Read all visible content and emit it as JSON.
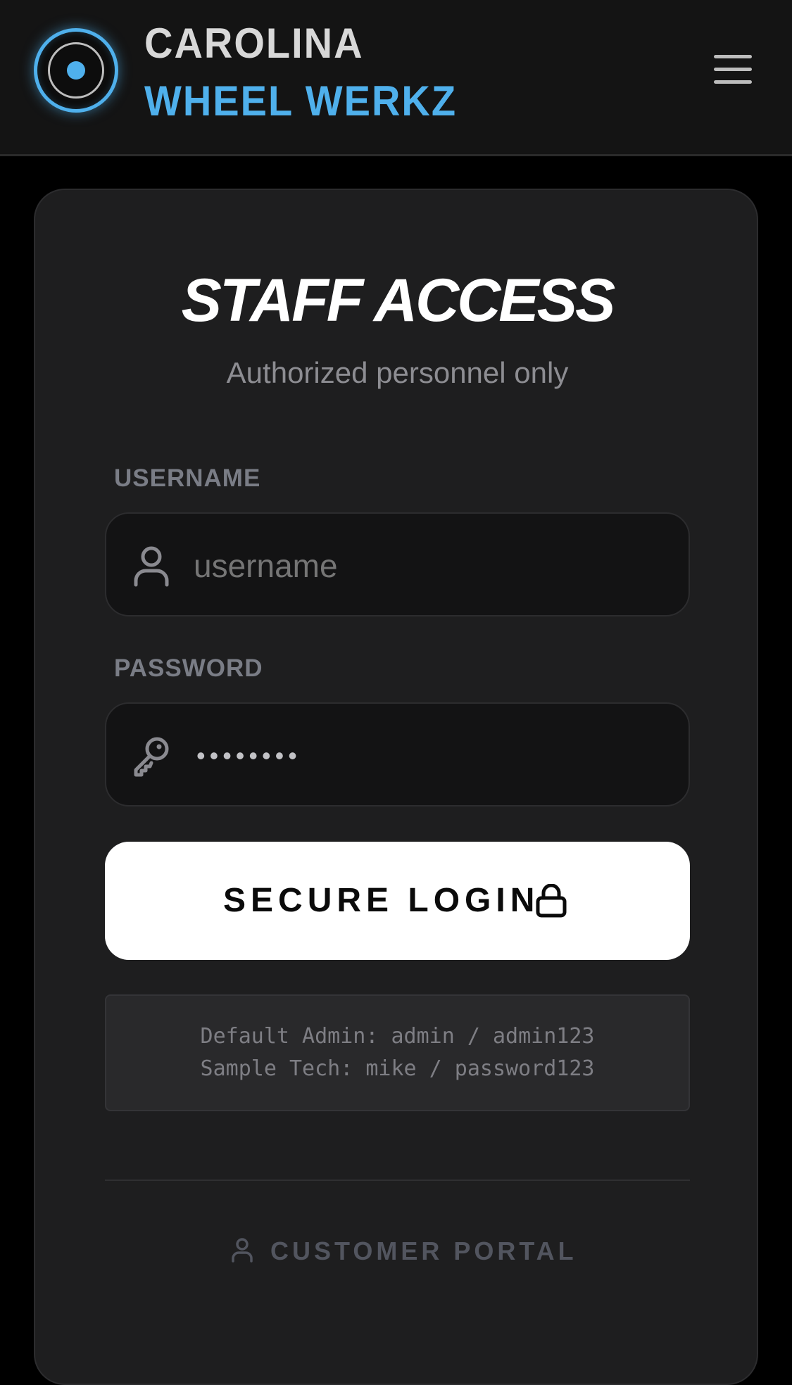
{
  "header": {
    "brand_line1": "CAROLINA",
    "brand_line2": "WHEEL WERKZ",
    "logo_icon": "wheel-logo-icon",
    "menu_icon": "hamburger-menu-icon"
  },
  "login": {
    "title": "STAFF ACCESS",
    "subtitle": "Authorized personnel only",
    "username": {
      "label": "USERNAME",
      "placeholder": "username",
      "value": "",
      "icon": "user-icon"
    },
    "password": {
      "label": "PASSWORD",
      "masked_value": "••••••••",
      "icon": "key-icon"
    },
    "submit": {
      "label": "SECURE LOGIN",
      "icon": "lock-icon"
    },
    "default_credentials": {
      "line1": "Default Admin: admin / admin123",
      "line2": "Sample Tech: mike / password123"
    },
    "customer_portal": {
      "label": "CUSTOMER PORTAL",
      "icon": "user-icon"
    }
  },
  "colors": {
    "accent": "#4fb0ec",
    "background": "#000000",
    "card": "#1e1e1f",
    "button": "#ffffff"
  }
}
